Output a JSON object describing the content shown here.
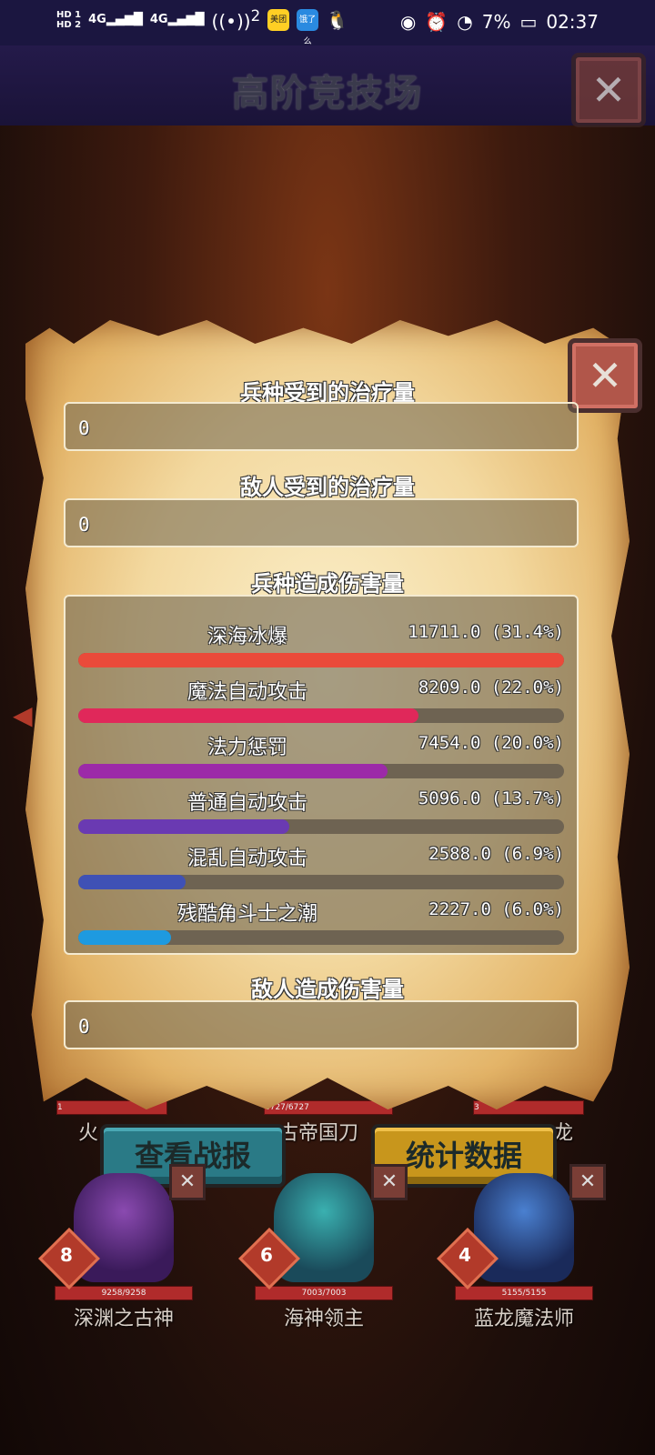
{
  "status_bar": {
    "hd1": "HD 1",
    "hd2": "HD 2",
    "net1": "4G",
    "net2": "4G",
    "hotspot_count": "2",
    "app1": "美团",
    "app2": "饿了么",
    "battery": "7%",
    "time": "02:37"
  },
  "header": {
    "title": "高阶竞技场"
  },
  "stats": {
    "heal_troops_label": "兵种受到的治疗量",
    "heal_troops_value": "0",
    "heal_enemy_label": "敌人受到的治疗量",
    "heal_enemy_value": "0",
    "damage_troops_label": "兵种造成伤害量",
    "damage_enemy_label": "敌人造成伤害量",
    "damage_enemy_value": "0"
  },
  "chart_data": {
    "type": "bar",
    "title": "兵种造成伤害量",
    "categories": [
      "深海冰爆",
      "魔法自动攻击",
      "法力惩罚",
      "普通自动攻击",
      "混乱自动攻击",
      "残酷角斗士之潮"
    ],
    "values": [
      11711.0,
      8209.0,
      7454.0,
      5096.0,
      2588.0,
      2227.0
    ],
    "labels": [
      "11711.0 (31.4%)",
      "8209.0 (22.0%)",
      "7454.0 (20.0%)",
      "5096.0 (13.7%)",
      "2588.0 (6.9%)",
      "2227.0 (6.0%)"
    ],
    "colors": [
      "#ea4a3a",
      "#e0285a",
      "#9c2aa8",
      "#6a3ab2",
      "#3f51b5",
      "#1e9ae0"
    ],
    "max": 11711.0
  },
  "buttons": {
    "report": "查看战报",
    "stats": "统计数据"
  },
  "units_top": {
    "left_hp": "1",
    "left_name": "火",
    "mid_hp": "6727/6727",
    "mid_name": "古帝国刀",
    "right_hp": "3",
    "right_name": "龙"
  },
  "units": [
    {
      "level": "8",
      "hp": "9258/9258",
      "name": "深渊之古神",
      "color": "#5a2a7a"
    },
    {
      "level": "6",
      "hp": "7003/7003",
      "name": "海神领主",
      "color": "#1e6a70"
    },
    {
      "level": "4",
      "hp": "5155/5155",
      "name": "蓝龙魔法师",
      "color": "#2a4a8a"
    }
  ]
}
